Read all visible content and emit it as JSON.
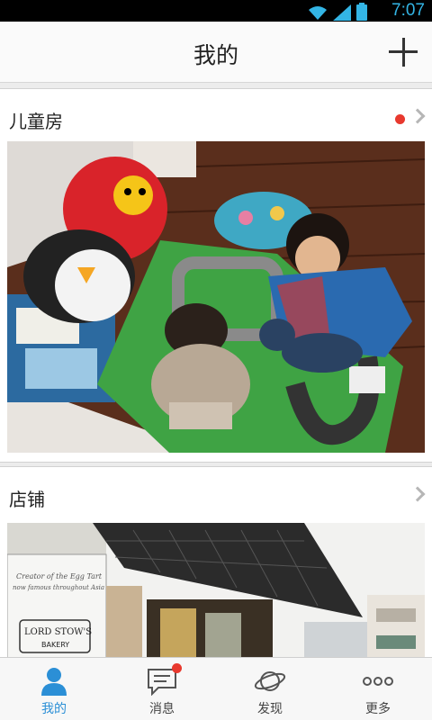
{
  "status_bar": {
    "time": "7:07"
  },
  "header": {
    "title": "我的",
    "add_icon": "plus-icon"
  },
  "cards": [
    {
      "title": "儿童房",
      "has_unread_dot": true
    },
    {
      "title": "店铺",
      "has_unread_dot": false
    }
  ],
  "photo2_sign": {
    "line1": "LORD STOW'S",
    "line2": "BAKERY",
    "line3": "Creator of the Egg Tart",
    "line4": "now famous throughout Asia"
  },
  "tabs": [
    {
      "label": "我的",
      "icon": "person-icon",
      "active": true
    },
    {
      "label": "消息",
      "icon": "message-icon",
      "badge": true
    },
    {
      "label": "发现",
      "icon": "planet-icon"
    },
    {
      "label": "更多",
      "icon": "more-dots-icon"
    }
  ],
  "colors": {
    "accent": "#2b8fd6",
    "badge": "#e8392e",
    "status_text": "#33b5e5"
  }
}
